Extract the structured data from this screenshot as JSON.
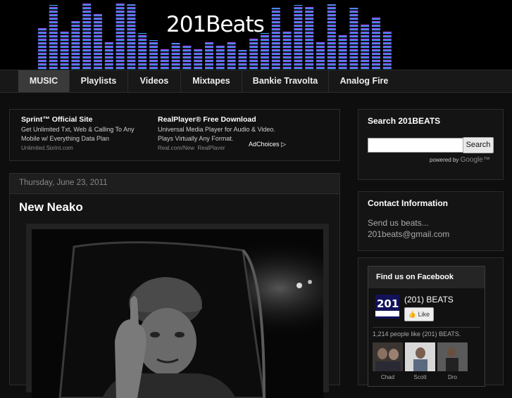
{
  "header": {
    "logo_text": "201Beats",
    "eq_colors": {
      "top": "#b23ef0",
      "bottom": "#20b8f0"
    }
  },
  "nav": {
    "items": [
      {
        "label": "MUSIC",
        "active": true
      },
      {
        "label": "Playlists"
      },
      {
        "label": "Videos"
      },
      {
        "label": "Mixtapes"
      },
      {
        "label": "Bankie Travolta"
      },
      {
        "label": "Analog Fire"
      }
    ]
  },
  "ads": {
    "items": [
      {
        "title": "Sprint™ Official Site",
        "body": [
          "Get Unlimited Txt, Web & Calling To Any",
          "Mobile w/ Everything Data Plan"
        ],
        "url": "Unlimited.Sprint.com"
      },
      {
        "title": "RealPlayer® Free Download",
        "body": [
          "Universal Media Player for Audio & Video.",
          "Plays Virtually Any Format."
        ],
        "url": "Real.com/New_RealPlayer"
      }
    ],
    "adchoices": "AdChoices ▷"
  },
  "post": {
    "date": "Thursday, June 23, 2011",
    "title": "New Neako"
  },
  "sidebar": {
    "search": {
      "title": "Search 201BEATS",
      "input_value": "",
      "button": "Search",
      "powered_by": "powered by",
      "google": "Google™"
    },
    "contact": {
      "title": "Contact Information",
      "line1": "Send us beats...",
      "email": "201beats@gmail.com"
    },
    "facebook": {
      "title": "Find us on Facebook",
      "page_name": "(201) BEATS",
      "like_button": "Like",
      "like_count": "1,214 people like (201) BEATS.",
      "fans": [
        "Chad",
        "Scott",
        "Dro"
      ]
    }
  },
  "colors": {
    "background": "#0e0e0e",
    "panel": "#141414",
    "nav_active": "#3a3a3a"
  }
}
